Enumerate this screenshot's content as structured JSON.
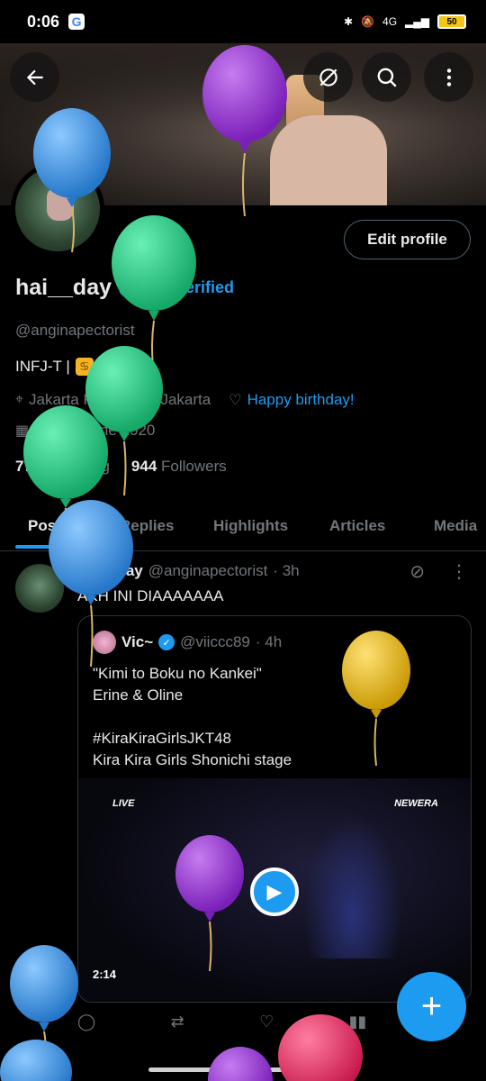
{
  "status_bar": {
    "time": "0:06",
    "g_badge": "G",
    "network": "4G",
    "battery": "50"
  },
  "header": {
    "back_icon": "back-arrow-icon",
    "grok_icon": "grok-icon",
    "search_icon": "search-icon",
    "more_icon": "more-vertical-icon"
  },
  "profile": {
    "edit_label": "Edit profile",
    "name": "hai__day",
    "get_verified": "Get Verified",
    "handle": "@anginapectorist",
    "bio": "INFJ-T |",
    "location": "Jakarta Pusat, DKI Jakarta",
    "birthday_link": "Happy birthday!",
    "joined": "Joined June 2020",
    "following_count": "770",
    "following_label": "Following",
    "followers_count": "944",
    "followers_label": "Followers"
  },
  "tabs": [
    {
      "label": "Posts"
    },
    {
      "label": "Replies"
    },
    {
      "label": "Highlights"
    },
    {
      "label": "Articles"
    },
    {
      "label": "Media"
    }
  ],
  "post": {
    "name": "hai__day",
    "handle": "@anginapectorist",
    "time": "· 3h",
    "text": "AKH INI DIAAAAAAA",
    "quote": {
      "name": "Vic~",
      "handle": "@viiccc89",
      "time": "· 4h",
      "lines": [
        "\"Kimi to Boku no Kankei\"",
        "Erine & Oline",
        "",
        "#KiraKiraGirlsJKT48",
        "Kira Kira Girls Shonichi stage"
      ],
      "video_live": "LIVE",
      "video_brand": "NEWERA",
      "duration": "2:14"
    }
  },
  "colors": {
    "accent": "#1d9bf0",
    "balloon_purple": "#8e2bd0",
    "balloon_blue": "#3f97e6",
    "balloon_green": "#1fcf86",
    "balloon_yellow": "#e6b816",
    "balloon_red": "#e63565"
  }
}
